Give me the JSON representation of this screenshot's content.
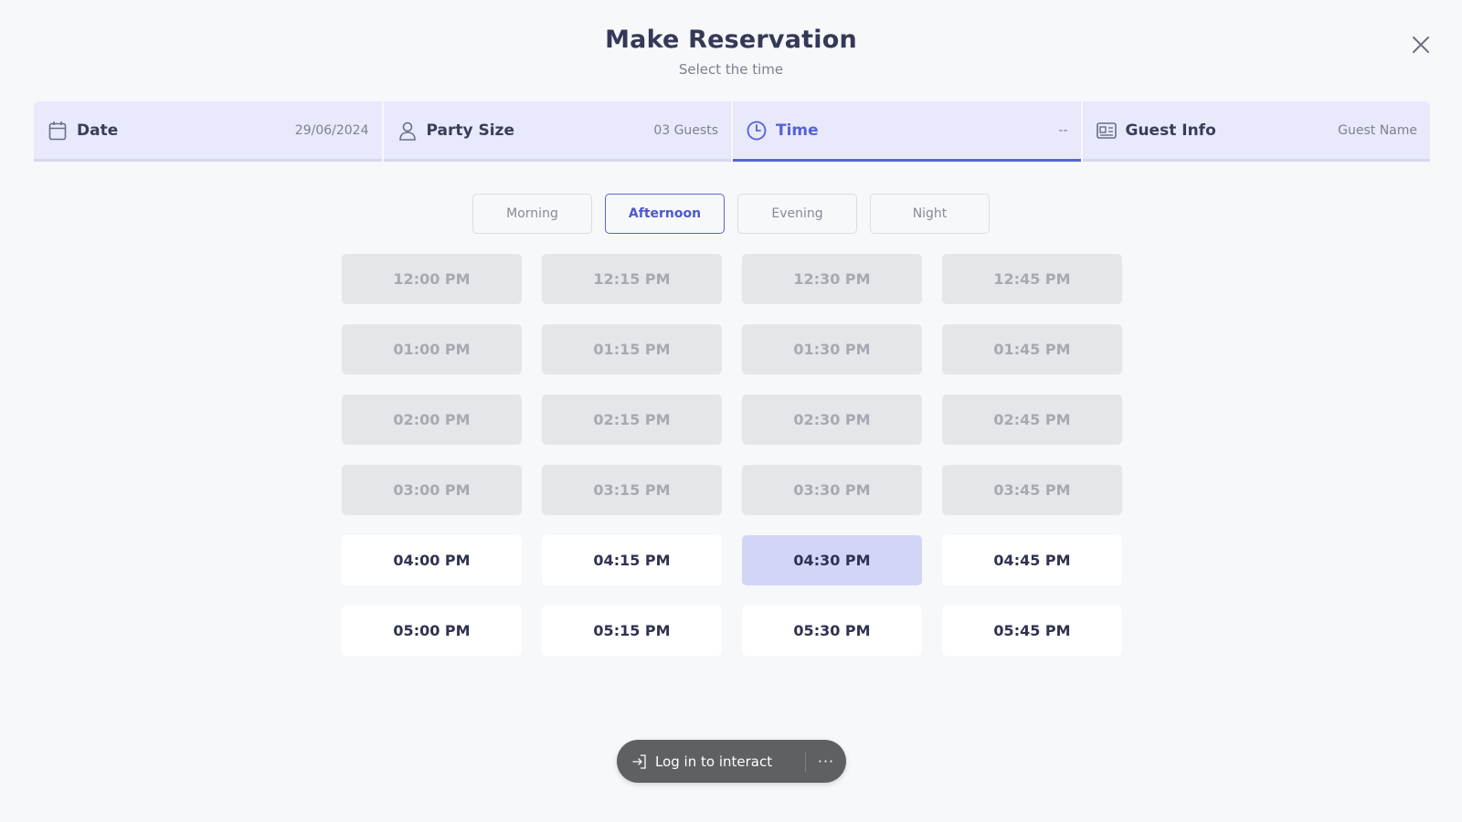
{
  "header": {
    "title": "Make Reservation",
    "subtitle": "Select the time"
  },
  "close_icon": "close-icon",
  "steps": [
    {
      "label": "Date",
      "value": "29/06/2024",
      "icon": "calendar-icon",
      "active": false
    },
    {
      "label": "Party Size",
      "value": "03 Guests",
      "icon": "person-icon",
      "active": false
    },
    {
      "label": "Time",
      "value": "--",
      "icon": "clock-icon",
      "active": true
    },
    {
      "label": "Guest Info",
      "value": "Guest Name",
      "icon": "id-card-icon",
      "active": false
    }
  ],
  "periods": [
    "Morning",
    "Afternoon",
    "Evening",
    "Night"
  ],
  "selected_period": "Afternoon",
  "time_slots": [
    {
      "label": "12:00 PM",
      "state": "disabled"
    },
    {
      "label": "12:15 PM",
      "state": "disabled"
    },
    {
      "label": "12:30 PM",
      "state": "disabled"
    },
    {
      "label": "12:45 PM",
      "state": "disabled"
    },
    {
      "label": "01:00 PM",
      "state": "disabled"
    },
    {
      "label": "01:15 PM",
      "state": "disabled"
    },
    {
      "label": "01:30 PM",
      "state": "disabled"
    },
    {
      "label": "01:45 PM",
      "state": "disabled"
    },
    {
      "label": "02:00 PM",
      "state": "disabled"
    },
    {
      "label": "02:15 PM",
      "state": "disabled"
    },
    {
      "label": "02:30 PM",
      "state": "disabled"
    },
    {
      "label": "02:45 PM",
      "state": "disabled"
    },
    {
      "label": "03:00 PM",
      "state": "disabled"
    },
    {
      "label": "03:15 PM",
      "state": "disabled"
    },
    {
      "label": "03:30 PM",
      "state": "disabled"
    },
    {
      "label": "03:45 PM",
      "state": "disabled"
    },
    {
      "label": "04:00 PM",
      "state": "available"
    },
    {
      "label": "04:15 PM",
      "state": "available"
    },
    {
      "label": "04:30 PM",
      "state": "selected"
    },
    {
      "label": "04:45 PM",
      "state": "available"
    },
    {
      "label": "05:00 PM",
      "state": "available"
    },
    {
      "label": "05:15 PM",
      "state": "available"
    },
    {
      "label": "05:30 PM",
      "state": "available"
    },
    {
      "label": "05:45 PM",
      "state": "available"
    }
  ],
  "toast": {
    "login_label": "Log in to interact",
    "login_icon": "login-icon",
    "more_label": "···",
    "more_icon": "more-icon"
  },
  "colors": {
    "accent": "#5964d6",
    "selected_slot": "#d2d5f7",
    "step_background": "#e8e9fb",
    "disabled_slot": "#e5e6e9"
  }
}
